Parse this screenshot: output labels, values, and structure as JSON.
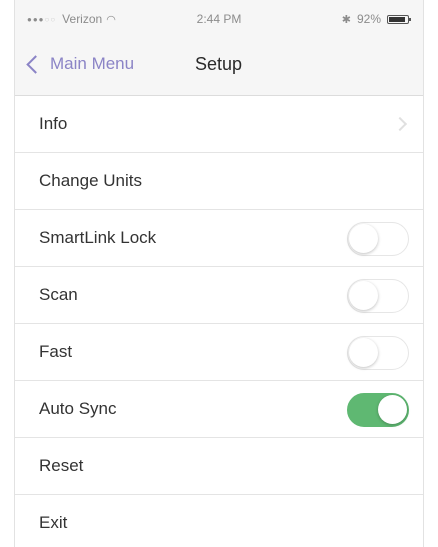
{
  "status_bar": {
    "carrier": "Verizon",
    "time": "2:44 PM",
    "battery_text": "92%",
    "battery_level": 0.92,
    "icons": [
      "signal-icon",
      "wifi-icon",
      "bluetooth-icon",
      "battery-icon"
    ]
  },
  "nav": {
    "back_label": "Main Menu",
    "title": "Setup"
  },
  "rows": [
    {
      "label": "Info",
      "accessory": "disclosure"
    },
    {
      "label": "Change Units",
      "accessory": "none"
    },
    {
      "label": "SmartLink Lock",
      "accessory": "toggle",
      "on": false
    },
    {
      "label": "Scan",
      "accessory": "toggle",
      "on": false
    },
    {
      "label": "Fast",
      "accessory": "toggle",
      "on": false
    },
    {
      "label": "Auto Sync",
      "accessory": "toggle",
      "on": true
    },
    {
      "label": "Reset",
      "accessory": "none"
    },
    {
      "label": "Exit",
      "accessory": "none"
    }
  ],
  "colors": {
    "accent": "#8b84c6",
    "toggle_on": "#5fb872"
  }
}
